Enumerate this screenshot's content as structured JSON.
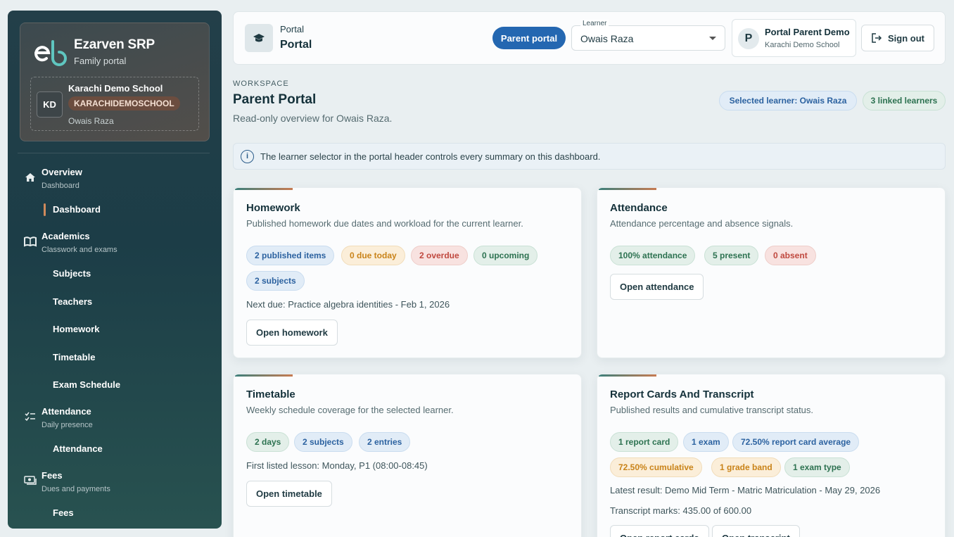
{
  "colors": {
    "primary": "#2467b1",
    "sidebar": "#1c3d47",
    "accent": "#c77b52"
  },
  "sidebar": {
    "brand_title": "Ezarven SRP",
    "brand_sub": "Family portal",
    "school_initials": "KD",
    "school_name": "Karachi Demo School",
    "school_code": "KARACHIDEMOSCHOOL",
    "school_learner": "Owais Raza",
    "groups": [
      {
        "title": "Overview",
        "sub": "Dashboard",
        "icon": "home-icon",
        "items": [
          "Dashboard"
        ]
      },
      {
        "title": "Academics",
        "sub": "Classwork and exams",
        "icon": "book-open-icon",
        "items": [
          "Subjects",
          "Teachers",
          "Homework",
          "Timetable",
          "Exam Schedule"
        ]
      },
      {
        "title": "Attendance",
        "sub": "Daily presence",
        "icon": "checklist-icon",
        "items": [
          "Attendance"
        ]
      },
      {
        "title": "Fees",
        "sub": "Dues and payments",
        "icon": "money-icon",
        "items": [
          "Fees"
        ]
      }
    ]
  },
  "topbar": {
    "portal_kicker": "Portal",
    "portal_title": "Portal",
    "parent_pill": "Parent portal",
    "learner_label": "Learner",
    "learner_value": "Owais Raza",
    "user_initial": "P",
    "user_name": "Portal Parent Demo",
    "user_school": "Karachi Demo School",
    "signout": "Sign out"
  },
  "workspace": {
    "kicker": "WORKSPACE",
    "title": "Parent Portal",
    "subtitle": "Read-only overview for Owais Raza.",
    "selected_badge": "Selected learner: Owais Raza",
    "linked_badge": "3 linked learners",
    "info": "The learner selector in the portal header controls every summary on this dashboard."
  },
  "cards": {
    "homework": {
      "title": "Homework",
      "desc": "Published homework due dates and workload for the current learner.",
      "chips": [
        "2 published items",
        "0 due today",
        "2 overdue",
        "0 upcoming",
        "2 subjects"
      ],
      "line1": "Next due: Practice algebra identities - Feb 1, 2026",
      "button": "Open homework"
    },
    "attendance": {
      "title": "Attendance",
      "desc": "Attendance percentage and absence signals.",
      "chips": [
        "100% attendance",
        "5 present",
        "0 absent"
      ],
      "button": "Open attendance"
    },
    "timetable": {
      "title": "Timetable",
      "desc": "Weekly schedule coverage for the selected learner.",
      "chips": [
        "2 days",
        "2 subjects",
        "2 entries"
      ],
      "line1": "First listed lesson: Monday, P1 (08:00-08:45)",
      "button": "Open timetable"
    },
    "report": {
      "title": "Report Cards And Transcript",
      "desc": "Published results and cumulative transcript status.",
      "chips": [
        "1 report card",
        "1 exam",
        "72.50% report card average",
        "72.50% cumulative",
        "1 grade band",
        "1 exam type"
      ],
      "line1": "Latest result: Demo Mid Term - Matric Matriculation - May 29, 2026",
      "line2": "Transcript marks: 435.00 of 600.00",
      "button1": "Open report cards",
      "button2": "Open transcript"
    }
  }
}
